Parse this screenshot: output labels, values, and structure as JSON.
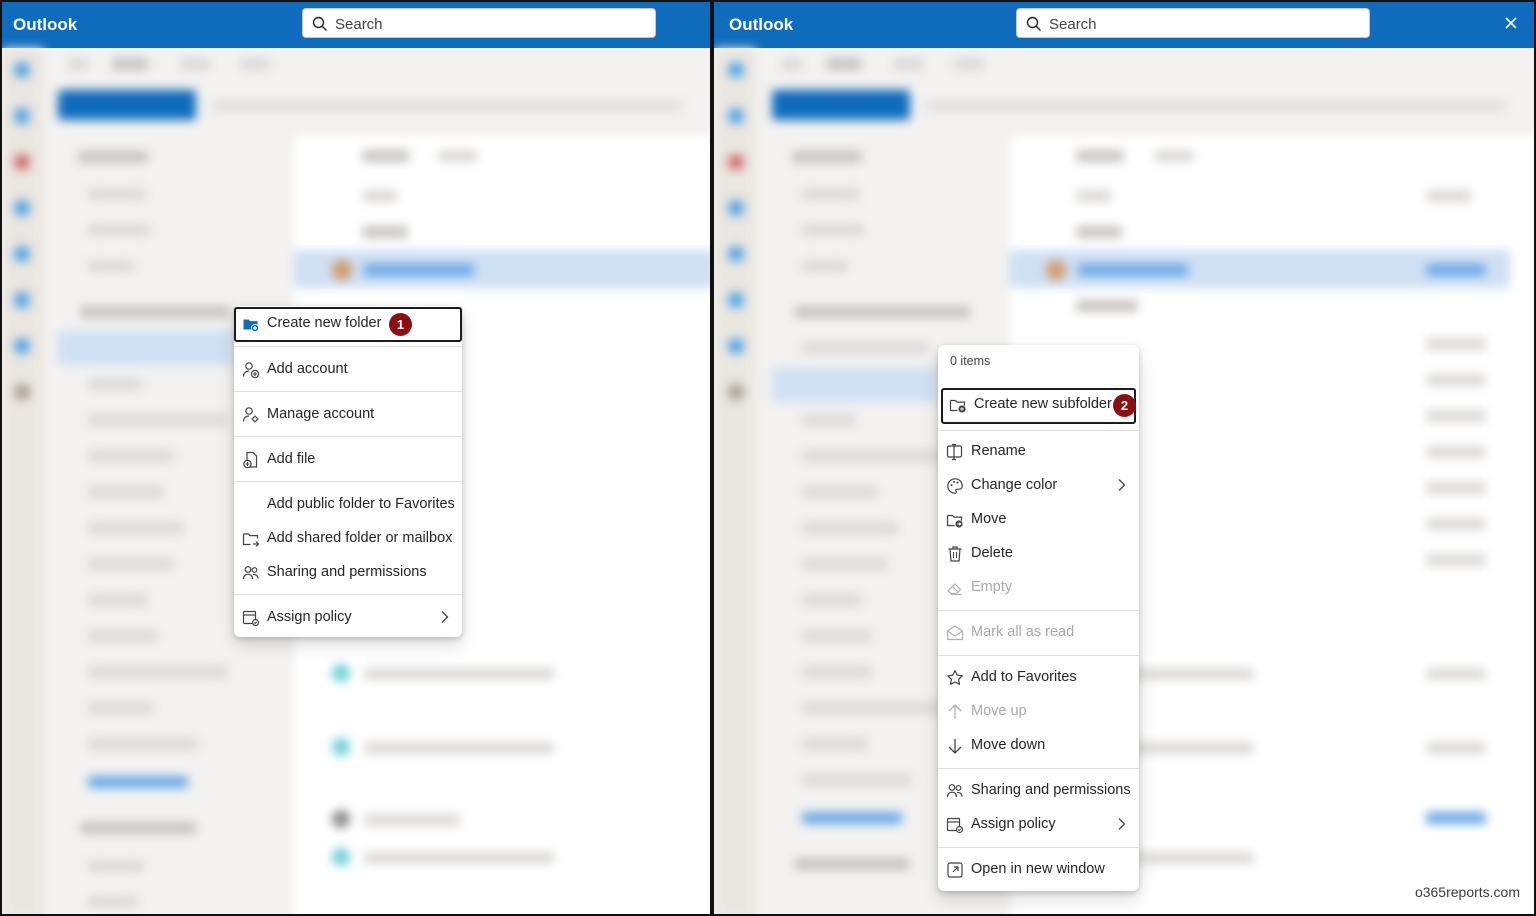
{
  "left_window": {
    "app_title": "Outlook",
    "search_placeholder": "Search",
    "menu": {
      "items": [
        {
          "label": "Create new folder",
          "icon": "folder-add-icon",
          "badge": "1"
        },
        {
          "label": "Add account",
          "icon": "person-add-icon"
        },
        {
          "label": "Manage account",
          "icon": "person-settings-icon"
        },
        {
          "label": "Add file",
          "icon": "document-add-icon"
        },
        {
          "label": "Add public folder to Favorites",
          "icon": ""
        },
        {
          "label": "Add shared folder or mailbox",
          "icon": "folder-link-icon"
        },
        {
          "label": "Sharing and permissions",
          "icon": "people-icon"
        },
        {
          "label": "Assign policy",
          "icon": "calendar-policy-icon",
          "submenu": true
        }
      ]
    }
  },
  "right_window": {
    "app_title": "Outlook",
    "search_placeholder": "Search",
    "menu": {
      "items_count": "0 items",
      "items": [
        {
          "label": "Create new subfolder",
          "icon": "folder-add-icon",
          "badge": "2"
        },
        {
          "label": "Rename",
          "icon": "rename-icon"
        },
        {
          "label": "Change color",
          "icon": "color-palette-icon",
          "submenu": true
        },
        {
          "label": "Move",
          "icon": "folder-move-icon"
        },
        {
          "label": "Delete",
          "icon": "trash-icon"
        },
        {
          "label": "Empty",
          "icon": "eraser-icon",
          "disabled": true
        },
        {
          "label": "Mark all as read",
          "icon": "mail-open-icon",
          "disabled": true
        },
        {
          "label": "Add to Favorites",
          "icon": "star-icon"
        },
        {
          "label": "Move up",
          "icon": "arrow-up-icon",
          "disabled": true
        },
        {
          "label": "Move down",
          "icon": "arrow-down-icon"
        },
        {
          "label": "Sharing and permissions",
          "icon": "people-icon"
        },
        {
          "label": "Assign policy",
          "icon": "calendar-policy-icon",
          "submenu": true
        },
        {
          "label": "Open in new window",
          "icon": "open-window-icon"
        }
      ]
    }
  },
  "watermark": "o365reports.com",
  "colors": {
    "titlebar": "#0f6cbd",
    "badge": "#8b0f12",
    "folder_icon_blue": "#0f6cbd"
  }
}
